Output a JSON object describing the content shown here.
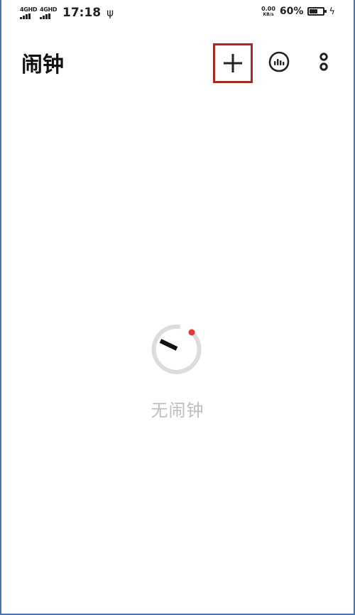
{
  "status_bar": {
    "network_1": "4GHD",
    "network_2": "4GHD",
    "time": "17:18",
    "usb_icon": "usb-icon",
    "speed_value": "0.00",
    "speed_unit": "KB/s",
    "battery_percent": "60%",
    "battery_level": 0.6,
    "charging_icon": "bolt-icon"
  },
  "app_bar": {
    "title": "闹钟",
    "actions": [
      {
        "name": "add",
        "icon": "plus-icon",
        "highlight_color": "#a52a22"
      },
      {
        "name": "ringtone",
        "icon": "sound-wave-icon"
      },
      {
        "name": "more",
        "icon": "more-vertical-icon"
      }
    ]
  },
  "empty_state": {
    "illustration": "alarm-clock-icon",
    "accent_color": "#e0393e",
    "text": "无闹钟"
  }
}
